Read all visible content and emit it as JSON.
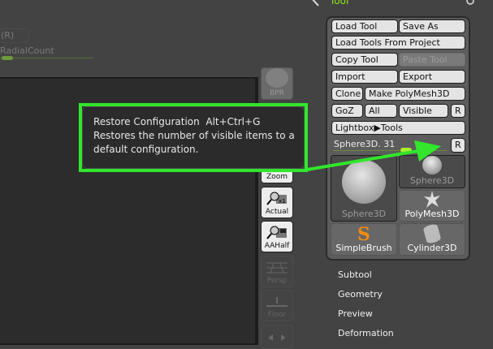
{
  "top": {
    "r_label": "(R)",
    "radial_count_label": "RadialCount"
  },
  "left_buttons": {
    "bpr": "BPR",
    "zoom": "Zoom",
    "actual": "Actual",
    "aahalf": "AAHalf",
    "persp": "Persp",
    "floor": "Floor"
  },
  "tool_palette": {
    "title": "Tool",
    "buttons": {
      "load_tool": "Load Tool",
      "save_as": "Save As",
      "load_from_project": "Load Tools From Project",
      "copy_tool": "Copy Tool",
      "paste_tool": "Paste Tool",
      "import": "Import",
      "export": "Export",
      "clone": "Clone",
      "make_polymesh": "Make PolyMesh3D",
      "goz": "GoZ",
      "all": "All",
      "visible": "Visible",
      "r": "R",
      "lightbox": "Lightbox▶Tools"
    },
    "slider": {
      "label": "Sphere3D. 31",
      "reset": "R",
      "value_fraction": 0.55
    },
    "thumbnails": [
      "Sphere3D",
      "Sphere3D",
      "PolyMesh3D",
      "SimpleBrush",
      "Cylinder3D"
    ]
  },
  "menu": [
    "Subtool",
    "Geometry",
    "Preview",
    "Deformation"
  ],
  "tooltip": {
    "title": "Restore Configuration  Alt+Ctrl+G",
    "line1": "Restores the number of visible items to a",
    "line2": "default configuration."
  },
  "colors": {
    "accent": "#8fe01a",
    "annotation": "#31e62c"
  }
}
